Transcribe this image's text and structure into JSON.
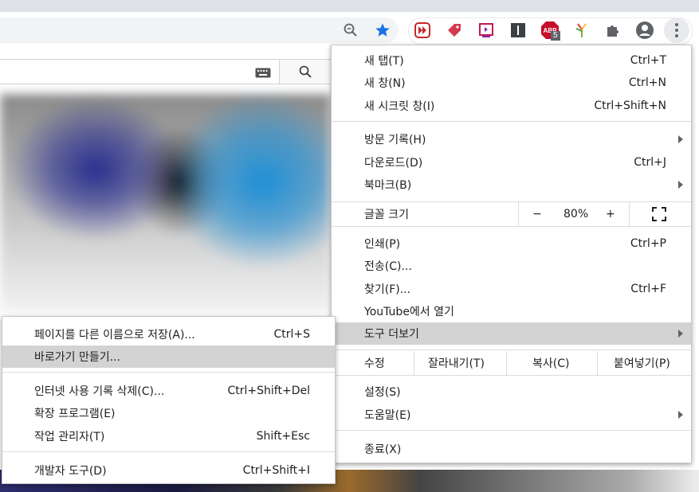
{
  "main_menu": {
    "items": [
      {
        "label": "새 탭(T)",
        "shortcut": "Ctrl+T"
      },
      {
        "label": "새 창(N)",
        "shortcut": "Ctrl+N"
      },
      {
        "label": "새 시크릿 창(I)",
        "shortcut": "Ctrl+Shift+N"
      },
      {
        "label": "방문 기록(H)",
        "shortcut": ""
      },
      {
        "label": "다운로드(D)",
        "shortcut": "Ctrl+J"
      },
      {
        "label": "북마크(B)",
        "shortcut": ""
      },
      {
        "label": "인쇄(P)",
        "shortcut": "Ctrl+P"
      },
      {
        "label": "전송(C)...",
        "shortcut": ""
      },
      {
        "label": "찾기(F)...",
        "shortcut": "Ctrl+F"
      },
      {
        "label": "YouTube에서 열기",
        "shortcut": ""
      },
      {
        "label": "도구 더보기",
        "shortcut": ""
      },
      {
        "label": "설정(S)",
        "shortcut": ""
      },
      {
        "label": "도움말(E)",
        "shortcut": ""
      },
      {
        "label": "종료(X)",
        "shortcut": ""
      }
    ],
    "zoom": {
      "label": "글꼴 크기",
      "minus": "−",
      "value": "80%",
      "plus": "+"
    },
    "edit": {
      "label": "수정",
      "cut": "잘라내기(T)",
      "copy": "복사(C)",
      "paste": "붙여넣기(P)"
    }
  },
  "submenu": {
    "items": [
      {
        "label": "페이지를 다른 이름으로 저장(A)...",
        "shortcut": "Ctrl+S"
      },
      {
        "label": "바로가기 만들기...",
        "shortcut": ""
      },
      {
        "label": "인터넷 사용 기록 삭제(C)...",
        "shortcut": "Ctrl+Shift+Del"
      },
      {
        "label": "확장 프로그램(E)",
        "shortcut": ""
      },
      {
        "label": "작업 관리자(T)",
        "shortcut": "Shift+Esc"
      },
      {
        "label": "개발자 도구(D)",
        "shortcut": "Ctrl+Shift+I"
      }
    ]
  },
  "toolbar": {
    "abp_badge": "5",
    "abp_text": "ABP",
    "icons": [
      "zoom-icon",
      "bookmark-star-icon",
      "extension-fast-forward-icon",
      "extension-tag-icon",
      "extension-screenshot-icon",
      "extension-instapaper-icon",
      "adblock-plus-icon",
      "extension-feather-icon",
      "extensions-puzzle-icon",
      "profile-avatar-icon",
      "more-menu-icon"
    ]
  },
  "colors": {
    "star": "#1a73e8",
    "menu_highlight": "#d3d3d3",
    "abp_red": "#c70d2c"
  }
}
